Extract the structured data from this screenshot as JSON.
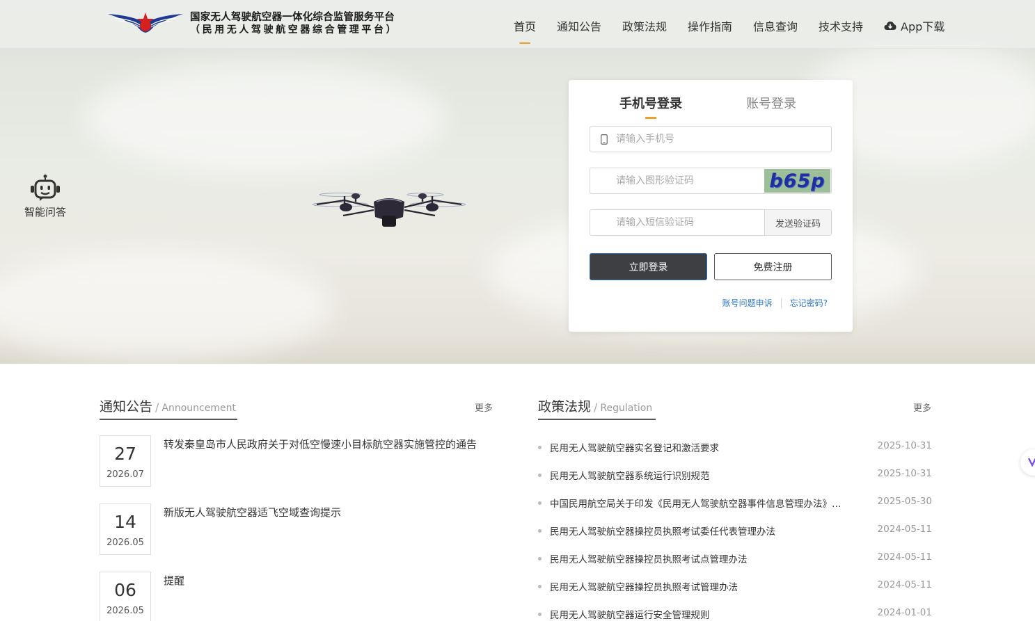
{
  "header": {
    "platform_name": "国家无人驾驶航空器一体化综合监管服务平台",
    "platform_subtitle": "（民用无人驾驶航空器综合管理平台）",
    "nav": [
      {
        "label": "首页",
        "active": true
      },
      {
        "label": "通知公告"
      },
      {
        "label": "政策法规"
      },
      {
        "label": "操作指南"
      },
      {
        "label": "信息查询"
      },
      {
        "label": "技术支持"
      }
    ],
    "app_download": "App下载"
  },
  "assistant": {
    "label": "智能问答"
  },
  "login": {
    "tabs": [
      "手机号登录",
      "账号登录"
    ],
    "phone_placeholder": "请输入手机号",
    "captcha_placeholder": "请输入图形验证码",
    "captcha_text": "b65p",
    "sms_placeholder": "请输入短信验证码",
    "send_code": "发送验证码",
    "login_button": "立即登录",
    "register_button": "免费注册",
    "appeal_link": "账号问题申诉",
    "forgot_link": "忘记密码?"
  },
  "announcements": {
    "title": "通知公告",
    "subtitle": "Announcement",
    "more": "更多",
    "items": [
      {
        "day": "27",
        "ym": "2026.07",
        "title": "转发秦皇岛市人民政府关于对低空慢速小目标航空器实施管控的通告"
      },
      {
        "day": "14",
        "ym": "2026.05",
        "title": "新版无人驾驶航空器适飞空域查询提示"
      },
      {
        "day": "06",
        "ym": "2026.05",
        "title": "提醒"
      }
    ]
  },
  "regulations": {
    "title": "政策法规",
    "subtitle": "Regulation",
    "more": "更多",
    "items": [
      {
        "title": "民用无人驾驶航空器实名登记和激活要求",
        "date": "2025-10-31"
      },
      {
        "title": "民用无人驾驶航空器系统运行识别规范",
        "date": "2025-10-31"
      },
      {
        "title": "中国民用航空局关于印发《民用无人驾驶航空器事件信息管理办法》的通知",
        "date": "2025-05-30"
      },
      {
        "title": "民用无人驾驶航空器操控员执照考试委任代表管理办法",
        "date": "2024-05-11"
      },
      {
        "title": "民用无人驾驶航空器操控员执照考试点管理办法",
        "date": "2024-05-11"
      },
      {
        "title": "民用无人驾驶航空器操控员执照考试管理办法",
        "date": "2024-05-11"
      },
      {
        "title": "民用无人驾驶航空器运行安全管理规则",
        "date": "2024-01-01"
      }
    ]
  },
  "colors": {
    "accent": "#f0a020",
    "link": "#2a74c9",
    "login_button": "#3d3f42"
  }
}
